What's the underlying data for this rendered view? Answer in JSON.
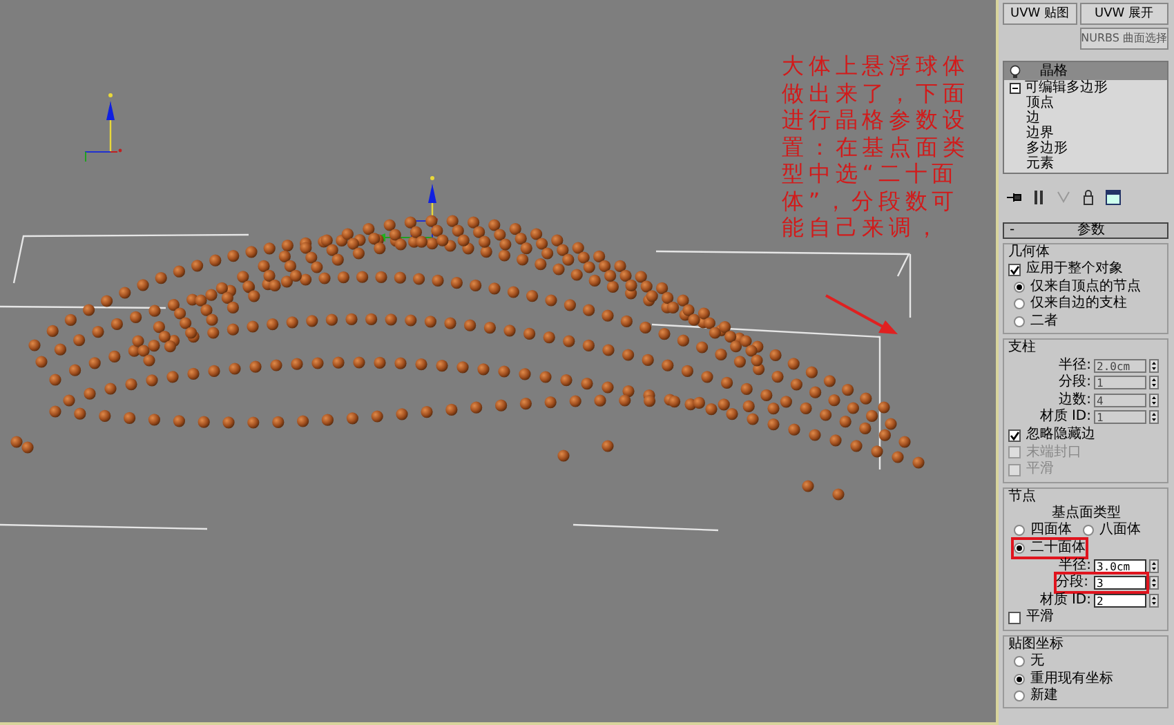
{
  "viewport": {
    "annotation": "大体上悬浮球体做出来了，下面进行晶格参数设置：在基点面类型中选“二十面体”，分段数可能自己来调，"
  },
  "command_panel": {
    "modifier_buttons": [
      {
        "label": "UVW 贴图"
      },
      {
        "label": "UVW 展开"
      },
      {
        "label": "NURBS 曲面选择"
      }
    ],
    "modifier_stack": {
      "header": "晶格",
      "items": [
        {
          "label": "可编辑多边形",
          "expanded": true,
          "children": [
            {
              "label": "顶点"
            },
            {
              "label": "边"
            },
            {
              "label": "边界"
            },
            {
              "label": "多边形"
            },
            {
              "label": "元素"
            }
          ]
        }
      ]
    },
    "rollout": {
      "collapse_sign": "-",
      "title": "参数"
    },
    "groups": [
      {
        "title": "几何体",
        "items": [
          {
            "kind": "checkbox",
            "label": "应用于整个对象",
            "checked": true,
            "disabled": false
          },
          {
            "kind": "radio",
            "label": "仅来自顶点的节点",
            "selected": true
          },
          {
            "kind": "radio",
            "label": "仅来自边的支柱",
            "selected": false
          },
          {
            "kind": "radio",
            "label": "二者",
            "selected": false
          }
        ]
      },
      {
        "title": "支柱",
        "items": [
          {
            "kind": "field",
            "label": "半径:",
            "value": "2.0cm",
            "disabled": true
          },
          {
            "kind": "field",
            "label": "分段:",
            "value": "1",
            "disabled": true
          },
          {
            "kind": "field",
            "label": "边数:",
            "value": "4",
            "disabled": true
          },
          {
            "kind": "field",
            "label": "材质 ID:",
            "value": "1",
            "disabled": true
          },
          {
            "kind": "checkbox",
            "label": "忽略隐藏边",
            "checked": true,
            "disabled": false
          },
          {
            "kind": "checkbox",
            "label": "末端封口",
            "checked": false,
            "disabled": true
          },
          {
            "kind": "checkbox",
            "label": "平滑",
            "checked": false,
            "disabled": true
          }
        ]
      },
      {
        "title": "节点",
        "items": [
          {
            "kind": "caption",
            "label": "基点面类型"
          },
          {
            "kind": "radio_row",
            "options": [
              {
                "label": "四面体",
                "selected": false
              },
              {
                "label": "八面体",
                "selected": false
              }
            ]
          },
          {
            "kind": "radio",
            "label": "二十面体",
            "selected": true,
            "highlighted": true
          },
          {
            "kind": "field",
            "label": "半径:",
            "value": "3.0cm",
            "disabled": false
          },
          {
            "kind": "field",
            "label": "分段:",
            "value": "3",
            "disabled": false,
            "highlighted": true
          },
          {
            "kind": "field",
            "label": "材质 ID:",
            "value": "2",
            "disabled": false
          },
          {
            "kind": "checkbox",
            "label": "平滑",
            "checked": false,
            "disabled": false
          }
        ]
      },
      {
        "title": "贴图坐标",
        "items": [
          {
            "kind": "radio",
            "label": "无",
            "selected": false
          },
          {
            "kind": "radio",
            "label": "重用现有坐标",
            "selected": true
          },
          {
            "kind": "radio",
            "label": "新建",
            "selected": false
          }
        ]
      }
    ]
  }
}
